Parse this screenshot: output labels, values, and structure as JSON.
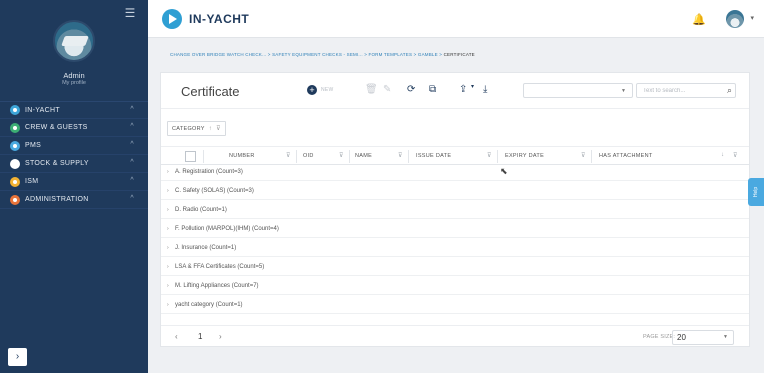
{
  "sidebar": {
    "user": {
      "name": "Admin",
      "link": "My profile"
    },
    "items": [
      {
        "label": "IN-YACHT",
        "icon_color": "#3ea6d8",
        "chevron": "^"
      },
      {
        "label": "CREW & GUESTS",
        "icon_color": "#3cae74",
        "chevron": "^"
      },
      {
        "label": "PMS",
        "icon_color": "#4aa9e0",
        "chevron": "^"
      },
      {
        "label": "STOCK & SUPPLY",
        "icon_color": "#ffffff",
        "chevron": "^"
      },
      {
        "label": "ISM",
        "icon_color": "#f2b233",
        "chevron": "^"
      },
      {
        "label": "ADMINISTRATION",
        "icon_color": "#e9743a",
        "chevron": "^"
      }
    ],
    "collapse_glyph": "›"
  },
  "header": {
    "brand": "IN-YACHT",
    "bell_glyph": "🔔"
  },
  "breadcrumb": {
    "path": "CHANGE OVER BRIDGE WATCH CHECK... > SAFETY EQUIPMENT CHECKS - SEMI... > FORM TEMPLATES > GAMBLE > ",
    "current": "CERTIFICATE"
  },
  "page": {
    "title": "Certificate",
    "new_label": "NEW",
    "search_placeholder": "Text to search..."
  },
  "grouping": {
    "chip_label": "CATEGORY",
    "sort_glyph": "↑",
    "filter_glyph": "⊽"
  },
  "columns": [
    {
      "label": "NUMBER"
    },
    {
      "label": "OID"
    },
    {
      "label": "NAME"
    },
    {
      "label": "ISSUE DATE"
    },
    {
      "label": "EXPIRY DATE"
    },
    {
      "label": "HAS ATTACHMENT"
    }
  ],
  "groups": [
    {
      "label": "A. Registration (Count=3)"
    },
    {
      "label": "C. Safety (SOLAS) (Count=3)"
    },
    {
      "label": "D. Radio (Count=1)"
    },
    {
      "label": "F. Pollution (MARPOL)(IHM) (Count=4)"
    },
    {
      "label": "J. Insurance (Count=1)"
    },
    {
      "label": "LSA & FFA Certificates (Count=5)"
    },
    {
      "label": "M. Lifting Appliances (Count=7)"
    },
    {
      "label": "yacht category (Count=1)"
    }
  ],
  "pager": {
    "prev": "‹",
    "current_page": "1",
    "next": "›",
    "page_size_label": "PAGE SIZE:",
    "page_size": "20"
  },
  "help": {
    "label": "Help"
  }
}
